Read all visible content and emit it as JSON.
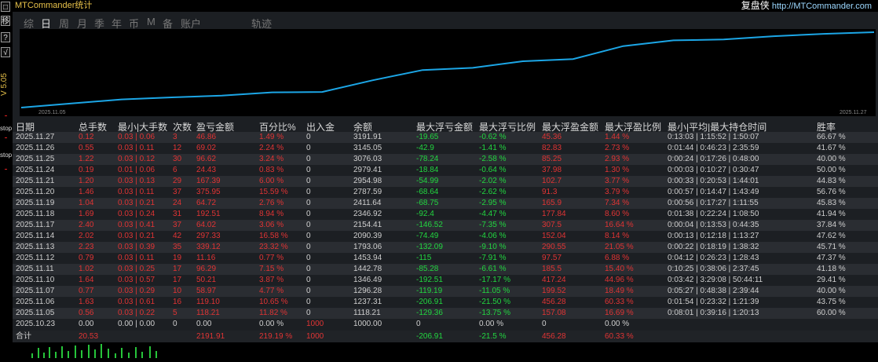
{
  "app": {
    "title": "MTCommander统计",
    "brand_cn": "复盘侠",
    "brand_url": "http://MTCommander.com"
  },
  "leftbar": {
    "buttons": [
      "□",
      "移",
      "?",
      "√"
    ],
    "version": "V 5.05",
    "stop1": "stop",
    "stop2": "stop"
  },
  "tabs": [
    {
      "label": "综",
      "active": false
    },
    {
      "label": "日",
      "active": true
    },
    {
      "label": "周",
      "active": false
    },
    {
      "label": "月",
      "active": false
    },
    {
      "label": "季",
      "active": false
    },
    {
      "label": "年",
      "active": false
    },
    {
      "label": "币",
      "active": false
    },
    {
      "label": "M",
      "active": false
    },
    {
      "label": "备",
      "active": false
    },
    {
      "label": "账户",
      "active": false
    },
    {
      "label": "轨迹",
      "active": false
    }
  ],
  "equity_chart": {
    "start_label": "2025.11.05",
    "end_label": "2025.11.27",
    "line_color": "#1ca6e6",
    "values": [
      1000.0,
      1118.21,
      1237.31,
      1296.28,
      1346.49,
      1442.78,
      1453.94,
      1793.06,
      2090.39,
      2154.41,
      2346.92,
      2411.64,
      2787.59,
      2954.98,
      2979.41,
      3076.03,
      3145.05,
      3191.91
    ]
  },
  "table": {
    "headers": [
      "日期",
      "总手数",
      "最小|大手数",
      "次数",
      "盈亏金额",
      "百分比%",
      "出入金",
      "余额",
      "最大浮亏金额",
      "最大浮亏比例",
      "最大浮盈金额",
      "最大浮盈比例",
      "最小|平均|最大持仓时间",
      "胜率"
    ],
    "rows": [
      [
        "2025.11.27",
        "0.12",
        "0.03 | 0.06",
        "3",
        "46.86",
        "1.49 %",
        "0",
        "3191.91",
        "-19.65",
        "-0.62 %",
        "45.36",
        "1.44 %",
        "0:13:03 | 1:15:52 | 1:50:07",
        "66.67 %"
      ],
      [
        "2025.11.26",
        "0.55",
        "0.03 | 0.11",
        "12",
        "69.02",
        "2.24 %",
        "0",
        "3145.05",
        "-42.9",
        "-1.41 %",
        "82.83",
        "2.73 %",
        "0:01:44 | 0:46:23 | 2:35:59",
        "41.67 %"
      ],
      [
        "2025.11.25",
        "1.22",
        "0.03 | 0.12",
        "30",
        "96.62",
        "3.24 %",
        "0",
        "3076.03",
        "-78.24",
        "-2.58 %",
        "85.25",
        "2.93 %",
        "0:00:24 | 0:17:26 | 0:48:00",
        "40.00 %"
      ],
      [
        "2025.11.24",
        "0.19",
        "0.01 | 0.06",
        "6",
        "24.43",
        "0.83 %",
        "0",
        "2979.41",
        "-18.84",
        "-0.64 %",
        "37.98",
        "1.30 %",
        "0:00:03 | 0:10:27 | 0:30:47",
        "50.00 %"
      ],
      [
        "2025.11.21",
        "1.20",
        "0.03 | 0.13",
        "29",
        "167.39",
        "6.00 %",
        "0",
        "2954.98",
        "-54.99",
        "-2.02 %",
        "102.7",
        "3.77 %",
        "0:00:33 | 0:20:53 | 1:44:01",
        "44.83 %"
      ],
      [
        "2025.11.20",
        "1.46",
        "0.03 | 0.11",
        "37",
        "375.95",
        "15.59 %",
        "0",
        "2787.59",
        "-68.64",
        "-2.62 %",
        "91.3",
        "3.79 %",
        "0:00:57 | 0:14:47 | 1:43:49",
        "56.76 %"
      ],
      [
        "2025.11.19",
        "1.04",
        "0.03 | 0.21",
        "24",
        "64.72",
        "2.76 %",
        "0",
        "2411.64",
        "-68.75",
        "-2.95 %",
        "165.9",
        "7.34 %",
        "0:00:56 | 0:17:27 | 1:11:55",
        "45.83 %"
      ],
      [
        "2025.11.18",
        "1.69",
        "0.03 | 0.24",
        "31",
        "192.51",
        "8.94 %",
        "0",
        "2346.92",
        "-92.4",
        "-4.47 %",
        "177.84",
        "8.60 %",
        "0:01:38 | 0:22:24 | 1:08:50",
        "41.94 %"
      ],
      [
        "2025.11.17",
        "2.40",
        "0.03 | 0.41",
        "37",
        "64.02",
        "3.06 %",
        "0",
        "2154.41",
        "-146.52",
        "-7.35 %",
        "307.5",
        "16.64 %",
        "0:00:04 | 0:13:53 | 0:44:35",
        "37.84 %"
      ],
      [
        "2025.11.14",
        "2.02",
        "0.03 | 0.21",
        "42",
        "297.33",
        "16.58 %",
        "0",
        "2090.39",
        "-74.49",
        "-4.06 %",
        "152.04",
        "8.14 %",
        "0:00:13 | 0:12:18 | 1:13:27",
        "47.62 %"
      ],
      [
        "2025.11.13",
        "2.23",
        "0.03 | 0.39",
        "35",
        "339.12",
        "23.32 %",
        "0",
        "1793.06",
        "-132.09",
        "-9.10 %",
        "290.55",
        "21.05 %",
        "0:00:22 | 0:18:19 | 1:38:32",
        "45.71 %"
      ],
      [
        "2025.11.12",
        "0.79",
        "0.03 | 0.11",
        "19",
        "11.16",
        "0.77 %",
        "0",
        "1453.94",
        "-115",
        "-7.91 %",
        "97.57",
        "6.88 %",
        "0:04:12 | 0:26:23 | 1:28:43",
        "47.37 %"
      ],
      [
        "2025.11.11",
        "1.02",
        "0.03 | 0.25",
        "17",
        "96.29",
        "7.15 %",
        "0",
        "1442.78",
        "-85.28",
        "-6.61 %",
        "185.5",
        "15.40 %",
        "0:10:25 | 0:38:06 | 2:37:45",
        "41.18 %"
      ],
      [
        "2025.11.10",
        "1.64",
        "0.03 | 0.57",
        "17",
        "50.21",
        "3.87 %",
        "0",
        "1346.49",
        "-192.51",
        "-17.17 %",
        "417.24",
        "44.96 %",
        "0:03:42 | 3:29:08 | 50:44:11",
        "29.41 %"
      ],
      [
        "2025.11.07",
        "0.77",
        "0.03 | 0.29",
        "10",
        "58.97",
        "4.77 %",
        "0",
        "1296.28",
        "-119.19",
        "-11.05 %",
        "199.52",
        "18.49 %",
        "0:05:27 | 0:48:38 | 2:39:44",
        "40.00 %"
      ],
      [
        "2025.11.06",
        "1.63",
        "0.03 | 0.61",
        "16",
        "119.10",
        "10.65 %",
        "0",
        "1237.31",
        "-206.91",
        "-21.50 %",
        "456.28",
        "60.33 %",
        "0:01:54 | 0:23:32 | 1:21:39",
        "43.75 %"
      ],
      [
        "2025.11.05",
        "0.56",
        "0.03 | 0.22",
        "5",
        "118.21",
        "11.82 %",
        "0",
        "1118.21",
        "-129.36",
        "-13.75 %",
        "157.08",
        "16.69 %",
        "0:08:01 | 0:39:16 | 1:20:13",
        "60.00 %"
      ],
      [
        "2025.10.23",
        "0.00",
        "0.00 | 0.00",
        "0",
        "0.00",
        "0.00 %",
        "1000",
        "1000.00",
        "0",
        "0.00 %",
        "0",
        "0.00 %",
        "",
        ""
      ]
    ],
    "total": [
      "合计",
      "20.53",
      "",
      "",
      "2191.91",
      "219.19 %",
      "1000",
      "",
      "-206.91",
      "-21.5 %",
      "456.28",
      "60.33 %",
      "",
      ""
    ]
  },
  "colors": {
    "negative": "#22d640",
    "positive": "#e13434",
    "neutral": "#cfcfcf"
  }
}
